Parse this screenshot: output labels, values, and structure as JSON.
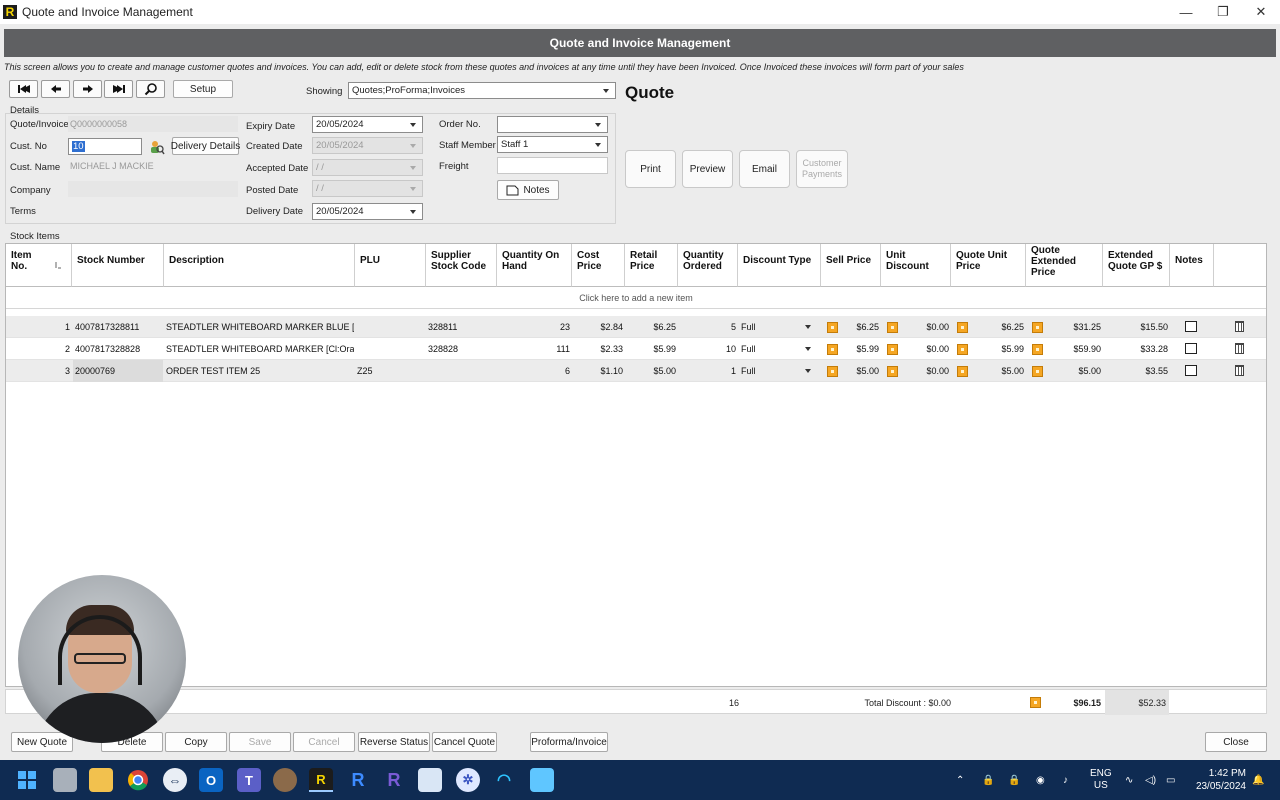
{
  "window": {
    "title": "Quote and Invoice Management",
    "logo_letter": "R",
    "controls": [
      "—",
      "❐",
      "✕"
    ]
  },
  "header": {
    "title": "Quote and Invoice Management"
  },
  "intro": "This screen allows you to create and manage customer quotes and invoices.  You can add, edit or delete stock from these quotes and invoices at any time until they have been Invoiced.  Once Invoiced these invoices will form part of your sales",
  "toolbar": {
    "setup_label": "Setup",
    "showing_label": "Showing",
    "showing_value": "Quotes;ProForma;Invoices"
  },
  "quote_heading": "Quote",
  "details": {
    "section_label": "Details",
    "quote_invoice_label": "Quote/Invoice",
    "quote_invoice_value": "Q0000000058",
    "cust_no_label": "Cust. No",
    "cust_no_value": "10",
    "delivery_details_label": "Delivery Details",
    "cust_name_label": "Cust. Name",
    "cust_name_value": "MICHAEL J MACKIE",
    "company_label": "Company",
    "company_value": "",
    "terms_label": "Terms",
    "terms_value": "",
    "expiry_date_label": "Expiry Date",
    "expiry_date_value": "20/05/2024",
    "created_date_label": "Created Date",
    "created_date_value": "20/05/2024",
    "accepted_date_label": "Accepted Date",
    "accepted_date_value": " /  /",
    "posted_date_label": "Posted Date",
    "posted_date_value": " /  /",
    "delivery_date_label": "Delivery Date",
    "delivery_date_value": "20/05/2024",
    "order_no_label": "Order No.",
    "order_no_value": "",
    "staff_member_label": "Staff Member",
    "staff_member_value": "Staff 1",
    "freight_label": "Freight",
    "freight_value": "",
    "notes_label": "Notes"
  },
  "actions": {
    "print": "Print",
    "preview": "Preview",
    "email": "Email",
    "customer_payments_1": "Customer",
    "customer_payments_2": "Payments"
  },
  "stock": {
    "section_label": "Stock Items",
    "columns": [
      {
        "l1": "Item",
        "l2": "No."
      },
      {
        "l1": "Stock Number",
        "l2": ""
      },
      {
        "l1": "Description",
        "l2": ""
      },
      {
        "l1": "PLU",
        "l2": ""
      },
      {
        "l1": "Supplier",
        "l2": "Stock Code"
      },
      {
        "l1": "Quantity On",
        "l2": "Hand"
      },
      {
        "l1": "Cost",
        "l2": "Price"
      },
      {
        "l1": "Retail",
        "l2": "Price"
      },
      {
        "l1": "Quantity",
        "l2": "Ordered"
      },
      {
        "l1": "Discount Type",
        "l2": ""
      },
      {
        "l1": "Sell Price",
        "l2": ""
      },
      {
        "l1": "Unit",
        "l2": "Discount"
      },
      {
        "l1": "Quote Unit",
        "l2": "Price"
      },
      {
        "l1": "Quote",
        "l2": "Extended",
        "l3": "Price"
      },
      {
        "l1": "Extended",
        "l2": "Quote GP $"
      },
      {
        "l1": "Notes",
        "l2": ""
      }
    ],
    "add_row_text": "Click here to add a new item",
    "rows": [
      {
        "item": "1",
        "stock_number": "4007817328811",
        "description": "STEADTLER WHITEBOARD MARKER BLUE [Cl:",
        "plu": "",
        "supplier_code": "328811",
        "qoh": "23",
        "cost": "$2.84",
        "retail": "$6.25",
        "qty": "5",
        "discount_type": "Full",
        "sell": "$6.25",
        "unit_discount": "$0.00",
        "quote_unit": "$6.25",
        "quote_ext": "$31.25",
        "ext_gp": "$15.50"
      },
      {
        "item": "2",
        "stock_number": "4007817328828",
        "description": "STEADTLER WHITEBOARD MARKER [Cl:Orang",
        "plu": "",
        "supplier_code": "328828",
        "qoh": "111",
        "cost": "$2.33",
        "retail": "$5.99",
        "qty": "10",
        "discount_type": "Full",
        "sell": "$5.99",
        "unit_discount": "$0.00",
        "quote_unit": "$5.99",
        "quote_ext": "$59.90",
        "ext_gp": "$33.28"
      },
      {
        "item": "3",
        "stock_number": "20000769",
        "description": "ORDER TEST ITEM 25",
        "plu": "Z25",
        "supplier_code": "",
        "qoh": "6",
        "cost": "$1.10",
        "retail": "$5.00",
        "qty": "1",
        "discount_type": "Full",
        "sell": "$5.00",
        "unit_discount": "$0.00",
        "quote_unit": "$5.00",
        "quote_ext": "$5.00",
        "ext_gp": "$3.55"
      }
    ],
    "totals": {
      "qty": "16",
      "total_discount": "Total Discount : $0.00",
      "quote_ext": "$96.15",
      "ext_gp": "$52.33"
    }
  },
  "bottom": {
    "new_quote": "New Quote",
    "delete": "Delete",
    "copy": "Copy",
    "save": "Save",
    "cancel": "Cancel",
    "reverse_status": "Reverse Status",
    "cancel_quote": "Cancel Quote",
    "proforma_invoice": "Proforma/Invoice",
    "close": "Close"
  },
  "taskbar": {
    "lang1": "ENG",
    "lang2": "US",
    "time": "1:42 PM",
    "date": "23/05/2024"
  },
  "colors": {
    "header_bg": "#5f6062",
    "taskbar_bg": "#0f2b52",
    "field_icon": "#f5a623",
    "selection": "#2f6fd0"
  }
}
